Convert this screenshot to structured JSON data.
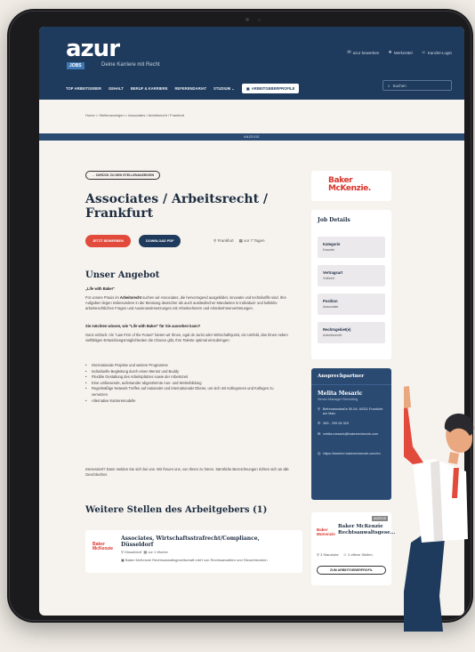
{
  "header": {
    "logo": "azur",
    "logo_badge": "JOBS",
    "slogan": "Deine Karriere mit Recht",
    "top_links": [
      "azur bewerben",
      "Merkzettel",
      "Kanzlei-Login"
    ],
    "nav": [
      "TOP ARBEITGEBER",
      "GEHALT",
      "BERUF & KARRIERE",
      "REFERENDARIAT",
      "STUDIUM"
    ],
    "employer_btn": "ARBEITGEBERPROFILE",
    "search_placeholder": "Suchen"
  },
  "breadcrumb": "Home  >  Stellenanzeigen  >  Associates / Arbeitsrecht / Frankfurt",
  "ad_label": "ANZEIGE",
  "back_button": "← ZURÜCK ZU DEN STELLENANZEIGEN",
  "job": {
    "title": "Associates / Arbeitsrecht / Frankfurt",
    "apply_button": "JETZT BEWERBEN",
    "pdf_button": "DOWNLOAD PDF",
    "location": "Frankfurt",
    "posted": "vor 7 Tagen"
  },
  "offer": {
    "heading": "Unser Angebot",
    "sub1": "„Life with Baker“",
    "para1_pre": "Für unsere Praxis im ",
    "para1_bold": "Arbeitsrecht",
    "para1_post": " suchen wir Associates, die hervorragend ausgebildet, innovativ und technikaffin sind. Ihre Aufgaben liegen insbesondere in der Beratung deutscher als auch ausländischer Mandanten in individual- und kollektiv arbeitsrechtlichen Fragen und Auseinandersetzungen mit Arbeitnehmern und Arbeitnehmervertretungen.",
    "sub2": "Sie möchten wissen, wie \"Life with Baker\" für Sie aussehen kann?",
    "para2": "Ganz einfach: Als \"Law Firm of the Future\" bieten wir Ihnen, egal ob Jurist oder Wirtschaftsjurist, ein Umfeld, das Ihnen neben vielfältigen Entwicklungsmöglichkeiten die Chance gibt, Ihre Talente optimal einzubringen:",
    "bullets": [
      "Internationale Projekte und weitere Programme",
      "Individuelle Begleitung durch einen Mentor und Buddy",
      "Flexible Gestaltung des Arbeitsplatzes sowie der Arbeitszeit",
      "Eine umfassende, aufeinander abgestimmte Aus- und Weiterbildung",
      "Regelmäßige Network Treffen auf nationaler und internationaler Ebene, um sich mit Kollegınnen und Kollegen zu vernetzen",
      "Alternative Karrieremodelle"
    ],
    "closing": "Interessiert? Dann melden Sie sich bei uns. Wir freuen uns, von Ihnen zu hören. Sämtliche Bezeichnungen richten sich an alle Geschlechter."
  },
  "more_jobs": {
    "heading": "Weitere Stellen des Arbeitgebers (1)",
    "card": {
      "logo": "Baker McKenzie",
      "title": "Associates, Wirtschaftsstrafrecht/Compliance, Düsseldorf",
      "location": "Düsseldorf",
      "posted": "vor 1 Woche",
      "company": "Baker McKenzie Rechtsanwaltsgesellschaft mbH von Rechtsanwälten und Steuerberatern"
    }
  },
  "sidebar": {
    "logo": "Baker McKenzie.",
    "details_title": "Job Details",
    "details": [
      {
        "key": "Kategorie",
        "value": "Kanzlei"
      },
      {
        "key": "Vertragsart",
        "value": "Vollzeit"
      },
      {
        "key": "Position",
        "value": "Associate"
      },
      {
        "key": "Rechtsgebiet(e)",
        "value": "Arbeitsrecht"
      }
    ],
    "contact": {
      "title": "Ansprechpartner",
      "name": "Melita Mesaric",
      "role": "Senior Manager Recruiting",
      "address": "Bethmannstraße 50-54, 60311 Frankfurt am Main",
      "phone": "069 - 299 08 325",
      "email": "melita.mesaric@bakermckenzie.com",
      "web": "https://karriere.bakermckenzie.com/en"
    },
    "employer": {
      "tag": "ANZEIGE",
      "logo": "Baker McKenzie",
      "name": "Baker McKenzie Rechtsanwaltsgese...",
      "locations": "3 Standorte",
      "openings": "2 offene Stellen",
      "button": "ZUM ARBEITGEBERPROFIL"
    }
  },
  "colors": {
    "navy": "#1e3a5c",
    "accent_red": "#e24a3c",
    "brand_red": "#d9342b"
  }
}
